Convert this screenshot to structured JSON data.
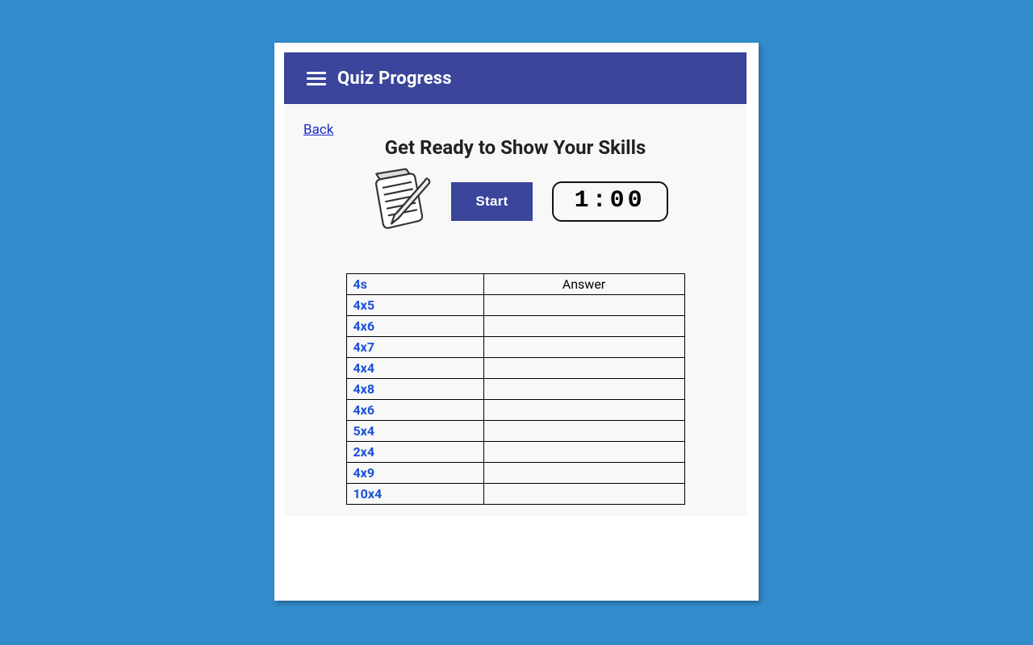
{
  "appbar": {
    "title": "Quiz Progress"
  },
  "back_label": "Back",
  "heading": "Get Ready to Show Your Skills",
  "start_label": "Start",
  "timer_text": "1:00",
  "table": {
    "question_header": "4s",
    "answer_header": "Answer",
    "rows": [
      {
        "q": "4x5",
        "a": ""
      },
      {
        "q": "4x6",
        "a": ""
      },
      {
        "q": "4x7",
        "a": ""
      },
      {
        "q": "4x4",
        "a": ""
      },
      {
        "q": "4x8",
        "a": ""
      },
      {
        "q": "4x6",
        "a": ""
      },
      {
        "q": "5x4",
        "a": ""
      },
      {
        "q": "2x4",
        "a": ""
      },
      {
        "q": "4x9",
        "a": ""
      },
      {
        "q": "10x4",
        "a": ""
      }
    ]
  }
}
